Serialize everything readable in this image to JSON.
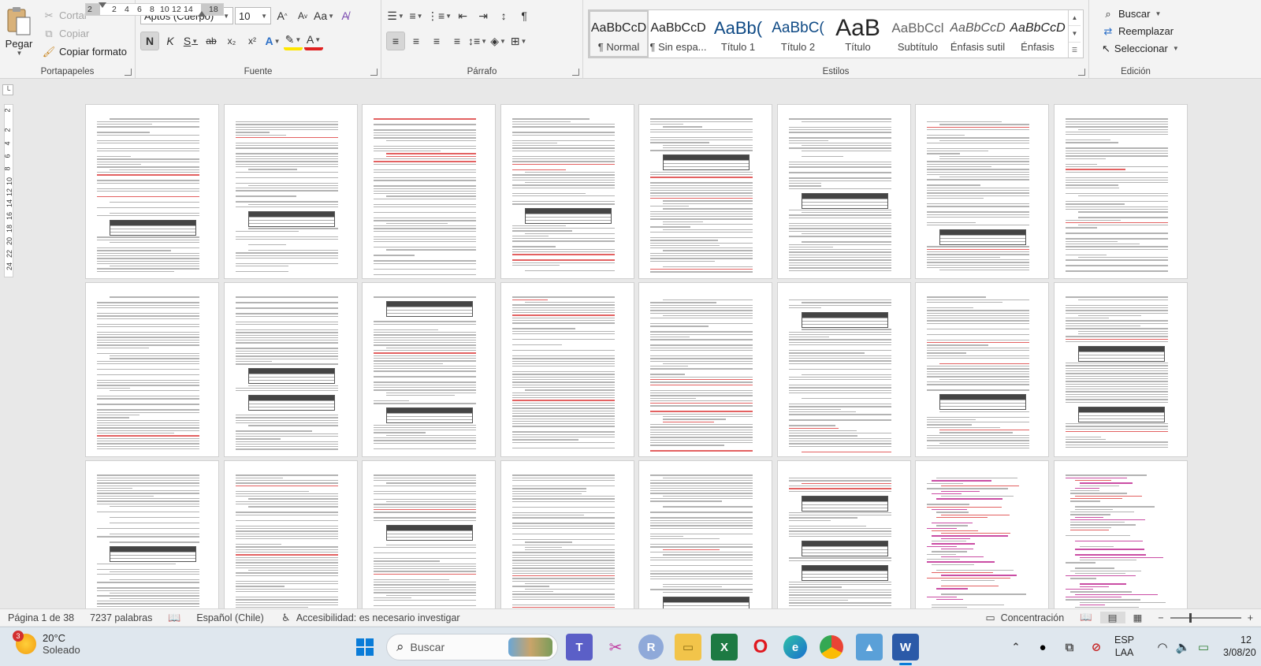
{
  "clipboard": {
    "paste": "Pegar",
    "cut": "Cortar",
    "copy": "Copiar",
    "format_painter": "Copiar formato",
    "group": "Portapapeles"
  },
  "font": {
    "name": "Aptos (Cuerpo)",
    "size": "10",
    "bold": "N",
    "italic": "K",
    "underline": "S",
    "strike": "ab",
    "sub": "x₂",
    "sup": "x²",
    "case": "Aa",
    "group": "Fuente"
  },
  "paragraph": {
    "group": "Párrafo"
  },
  "styles": {
    "group": "Estilos",
    "items": [
      {
        "preview": "AaBbCcD",
        "name": "¶ Normal"
      },
      {
        "preview": "AaBbCcD",
        "name": "¶ Sin espa..."
      },
      {
        "preview": "AaBb(",
        "name": "Título 1"
      },
      {
        "preview": "AaBbC(",
        "name": "Título 2"
      },
      {
        "preview": "AaB",
        "name": "Título"
      },
      {
        "preview": "AaBbCcl",
        "name": "Subtítulo"
      },
      {
        "preview": "AaBbCcD",
        "name": "Énfasis sutil"
      },
      {
        "preview": "AaBbCcD",
        "name": "Énfasis"
      }
    ]
  },
  "editing": {
    "find": "Buscar",
    "replace": "Reemplazar",
    "select": "Seleccionar",
    "group": "Edición"
  },
  "ruler": {
    "ticks": [
      "2",
      "2",
      "4",
      "6",
      "8",
      "10",
      "12",
      "14",
      "18"
    ],
    "vticks": [
      "2",
      "2",
      "4",
      "6",
      "8",
      "10",
      "12",
      "14",
      "16",
      "18",
      "20",
      "22",
      "24"
    ]
  },
  "status": {
    "page": "Página 1 de 38",
    "words": "7237 palabras",
    "language": "Español (Chile)",
    "accessibility": "Accesibilidad: es necesario investigar",
    "focus": "Concentración"
  },
  "taskbar": {
    "weather_temp": "20°C",
    "weather_desc": "Soleado",
    "weather_badge": "3",
    "search": "Buscar",
    "lang": "ESP",
    "layout": "LAA",
    "time": "12",
    "date": "3/08/20"
  }
}
